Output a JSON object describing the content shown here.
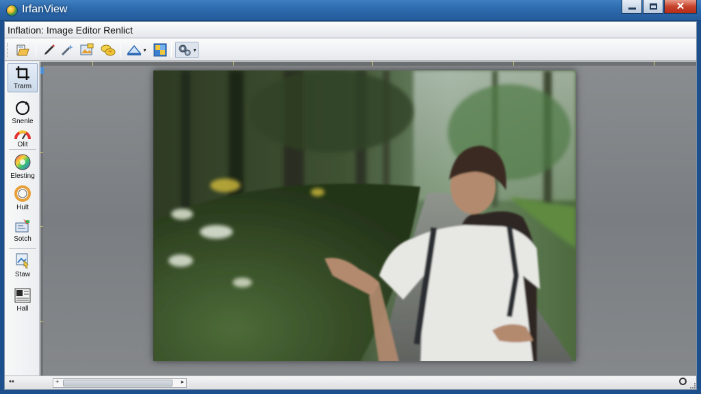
{
  "window": {
    "title": "IrfanView",
    "caption": "Inflation: Image Editor Renlict",
    "buttons": [
      "minimize",
      "maximize",
      "close"
    ],
    "close_glyph": "✕"
  },
  "toolbar": {
    "icons": [
      "open-folder-icon",
      "pen-icon",
      "magic-wand-icon",
      "image-edit-icon",
      "coins-icon",
      "shape-icon",
      "color-adjust-icon",
      "settings-gears-icon"
    ],
    "dropdown_arrow": "▾"
  },
  "tools": [
    {
      "id": "crop",
      "label": "Trarm",
      "icon": "crop-icon",
      "active": true
    },
    {
      "id": "rotate",
      "label": "Snenle",
      "icon": "rotate-icon"
    },
    {
      "id": "color",
      "label": "Olit",
      "icon": "color-gauge-icon"
    },
    {
      "id": "hue",
      "label": "Elesting",
      "icon": "color-wheel-icon"
    },
    {
      "id": "saturation",
      "label": "Hult",
      "icon": "ring-icon"
    },
    {
      "id": "sketch",
      "label": "Sotch",
      "icon": "sketch-icon"
    },
    {
      "id": "stamp",
      "label": "Staw",
      "icon": "stamp-icon"
    },
    {
      "id": "layout",
      "label": "Hall",
      "icon": "layout-icon"
    }
  ],
  "statusbar": {
    "left_text": "•▪",
    "scroll_left": "+",
    "scroll_right": "▸"
  },
  "colors": {
    "title_bar": "#2d6aad",
    "accent_blue": "#4f8fd6",
    "ruler_tick": "#d9d36a",
    "canvas_gray": "#808386"
  }
}
